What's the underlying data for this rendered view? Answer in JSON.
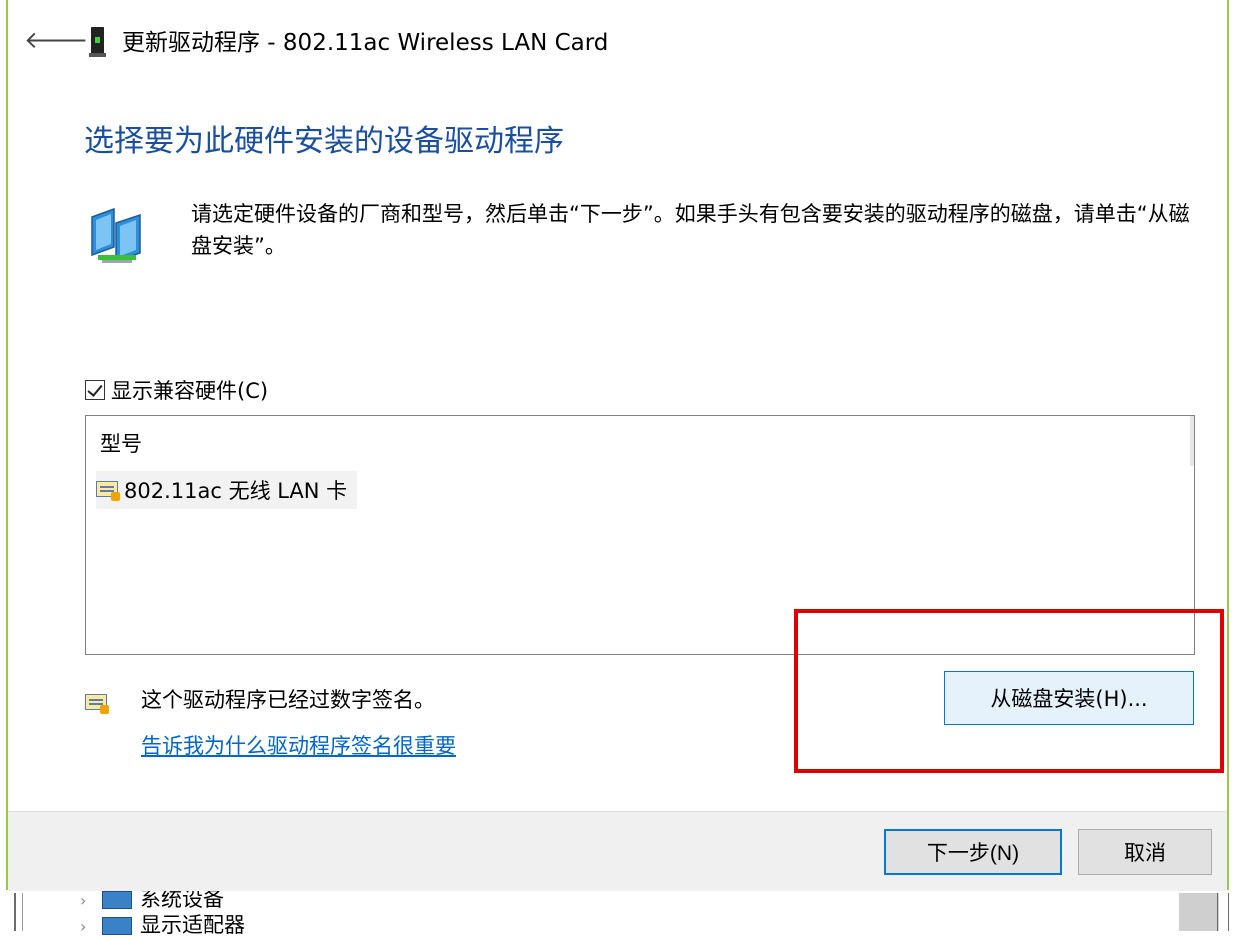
{
  "window": {
    "title": "更新驱动程序 - 802.11ac Wireless LAN Card",
    "back_icon": "back-arrow-icon",
    "device_icon": "device-icon"
  },
  "heading": "选择要为此硬件安装的设备驱动程序",
  "instructions": "请选定硬件设备的厂商和型号，然后单击“下一步”。如果手头有包含要安装的驱动程序的磁盘，请单击“从磁盘安装”。",
  "compatible_hardware": {
    "label": "显示兼容硬件(C)",
    "checked": true
  },
  "model_list": {
    "header": "型号",
    "items": [
      {
        "label": "802.11ac 无线 LAN 卡",
        "icon": "certificate-icon",
        "selected": true
      }
    ]
  },
  "signature": {
    "text": "这个驱动程序已经过数字签名。",
    "link": "告诉我为什么驱动程序签名很重要",
    "icon": "certificate-icon"
  },
  "buttons": {
    "have_disk": "从磁盘安装(H)...",
    "next": "下一步(N)",
    "cancel": "取消"
  },
  "background_window": {
    "items": [
      "系统设备",
      "显示适配器"
    ]
  },
  "colors": {
    "heading": "#1a4fa0",
    "link": "#0066cc",
    "dialog_border": "#9dc74a",
    "highlight": "#e00000",
    "accent_button": "#0078d7"
  }
}
